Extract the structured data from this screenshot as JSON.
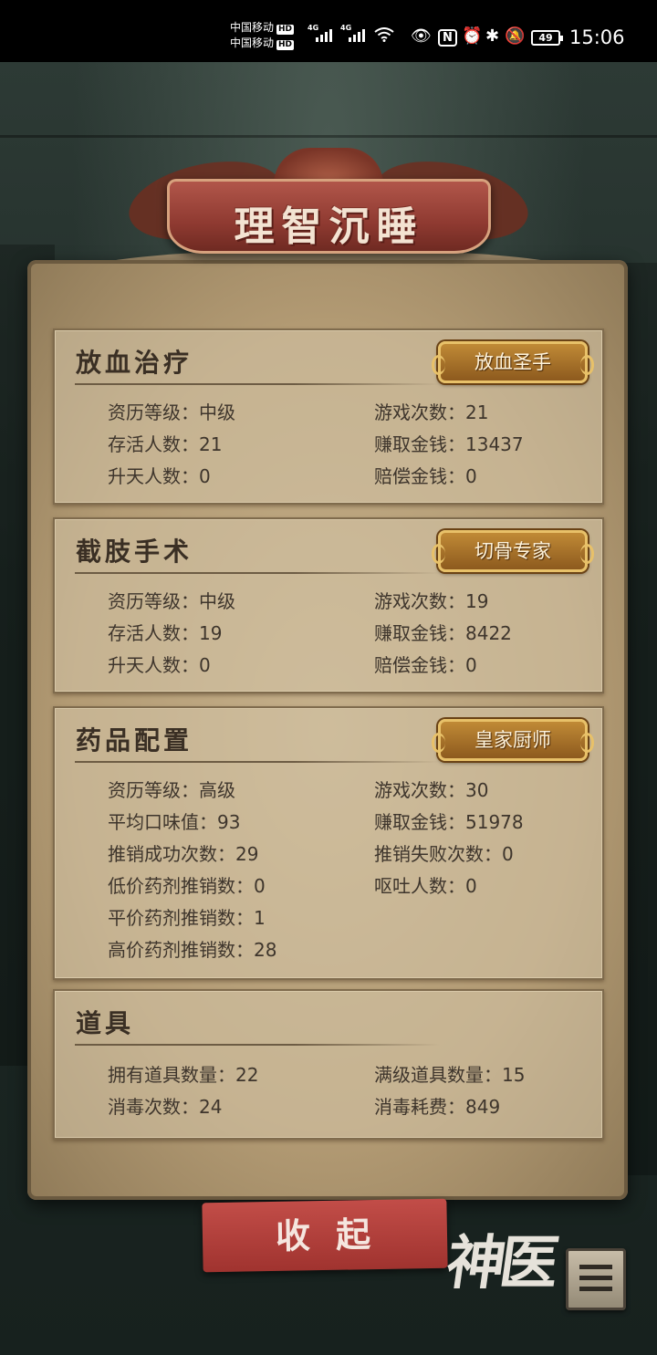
{
  "status_bar": {
    "carrier_1": "中国移动",
    "carrier_2": "中国移动",
    "hd_badge": "HD",
    "network_1": "4G",
    "network_2": "4G",
    "battery": "49",
    "time": "15:06"
  },
  "panel_title": "理智沉睡",
  "sections": [
    {
      "title": "放血治疗",
      "badge": "放血圣手",
      "stats_left": [
        "资历等级：中级",
        "存活人数：21",
        "升天人数：0"
      ],
      "stats_right": [
        "游戏次数：21",
        "赚取金钱：13437",
        "赔偿金钱：0"
      ]
    },
    {
      "title": "截肢手术",
      "badge": "切骨专家",
      "stats_left": [
        "资历等级：中级",
        "存活人数：19",
        "升天人数：0"
      ],
      "stats_right": [
        "游戏次数：19",
        "赚取金钱：8422",
        "赔偿金钱：0"
      ]
    },
    {
      "title": "药品配置",
      "badge": "皇家厨师",
      "stats_left": [
        "资历等级：高级",
        "平均口味值：93",
        "推销成功次数：29",
        "低价药剂推销数：0",
        "平价药剂推销数：1",
        "高价药剂推销数：28"
      ],
      "stats_right": [
        "游戏次数：30",
        "赚取金钱：51978",
        "推销失败次数：0",
        "呕吐人数：0"
      ]
    },
    {
      "title": "道具",
      "stats_left": [
        "拥有道具数量：22",
        "消毒次数：24"
      ],
      "stats_right": [
        "满级道具数量：15",
        "消毒耗费：849"
      ]
    }
  ],
  "collapse_button": "收起",
  "corner_art": "神医",
  "icons": {
    "eye": "👁",
    "nfc": "N",
    "alarm": "⏰",
    "bluetooth": "✱",
    "mute": "🔕"
  }
}
